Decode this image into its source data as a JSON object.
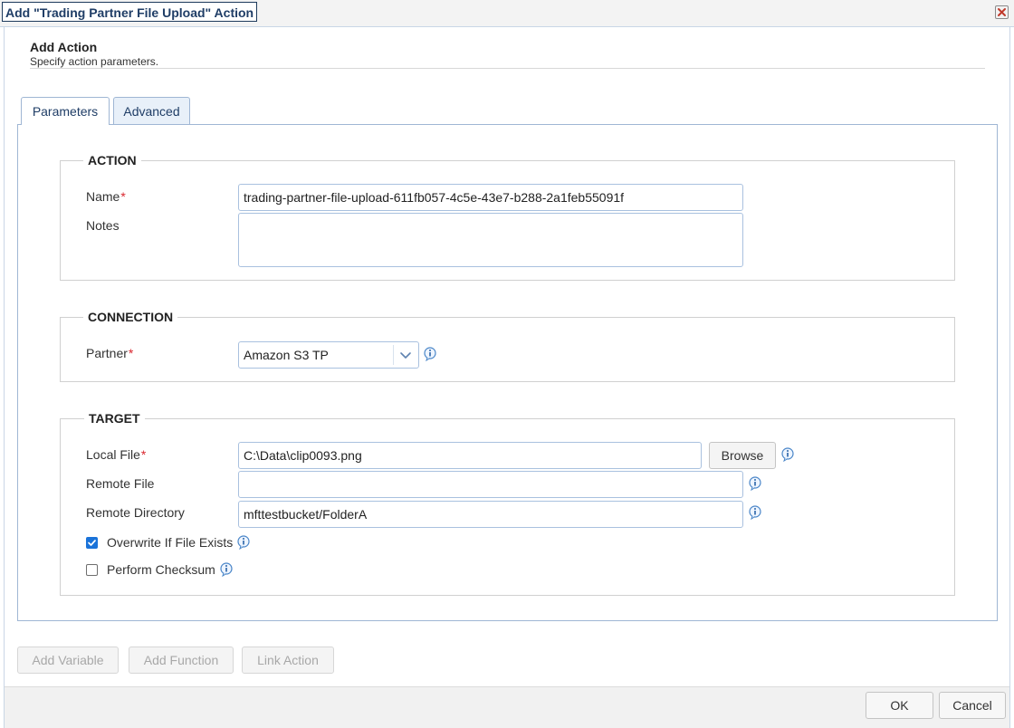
{
  "window": {
    "title": "Add \"Trading Partner File Upload\" Action"
  },
  "header": {
    "title": "Add Action",
    "subtitle": "Specify action parameters."
  },
  "tabs": [
    {
      "label": "Parameters"
    },
    {
      "label": "Advanced"
    }
  ],
  "action": {
    "legend": "ACTION",
    "name_label": "Name",
    "name_value": "trading-partner-file-upload-611fb057-4c5e-43e7-b288-2a1feb55091f",
    "notes_label": "Notes",
    "notes_value": ""
  },
  "connection": {
    "legend": "CONNECTION",
    "partner_label": "Partner",
    "partner_value": "Amazon S3 TP"
  },
  "target": {
    "legend": "TARGET",
    "local_file_label": "Local File",
    "local_file_value": "C:\\Data\\clip0093.png",
    "browse_label": "Browse",
    "remote_file_label": "Remote File",
    "remote_file_value": "",
    "remote_dir_label": "Remote Directory",
    "remote_dir_value": "mfttestbucket/FolderA",
    "overwrite_label": "Overwrite If File Exists",
    "overwrite_checked": true,
    "checksum_label": "Perform Checksum",
    "checksum_checked": false
  },
  "required_marker": "*",
  "bottom_buttons": {
    "add_variable": "Add Variable",
    "add_function": "Add Function",
    "link_action": "Link Action"
  },
  "footer": {
    "ok": "OK",
    "cancel": "Cancel"
  },
  "icons": {
    "close": "close-icon",
    "info": "info-icon",
    "dropdown": "chevron-down-icon",
    "check": "check-icon"
  },
  "colors": {
    "accent": "#1a73d9",
    "required": "#d9262e",
    "border": "#a9c1df",
    "title": "#1f3d66"
  }
}
